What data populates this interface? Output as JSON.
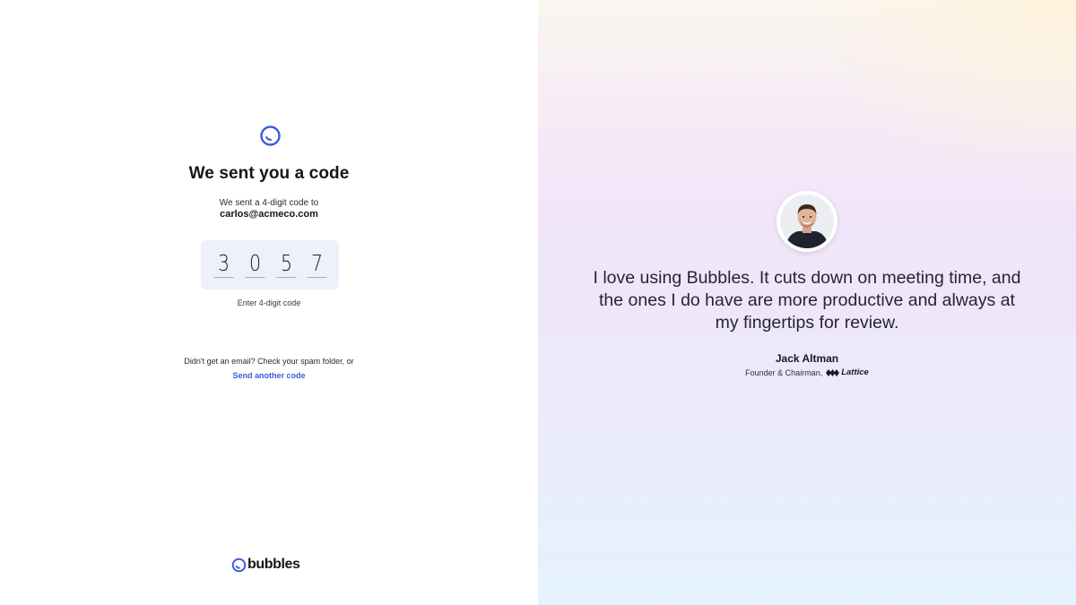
{
  "verify": {
    "title": "We sent you a code",
    "sent_text": "We sent a 4-digit code to",
    "email": "carlos@acmeco.com",
    "code_digits": [
      "3",
      "0",
      "5",
      "7"
    ],
    "hint": "Enter 4-digit code",
    "spam_text": "Didn't get an email? Check your spam folder, or",
    "resend_label": "Send another code"
  },
  "brand": {
    "name": "bubbles",
    "accent": "#3b5bdb"
  },
  "testimonial": {
    "quote": "I love using Bubbles. It cuts down on meeting time, and the ones I do have are more productive and always at my fingertips for review.",
    "author": "Jack Altman",
    "role": "Founder & Chairman,",
    "company": "Lattice"
  },
  "icons": {
    "logo": "bubbles-logo-icon",
    "company_logo": "lattice-logo-icon",
    "avatar": "avatar"
  }
}
